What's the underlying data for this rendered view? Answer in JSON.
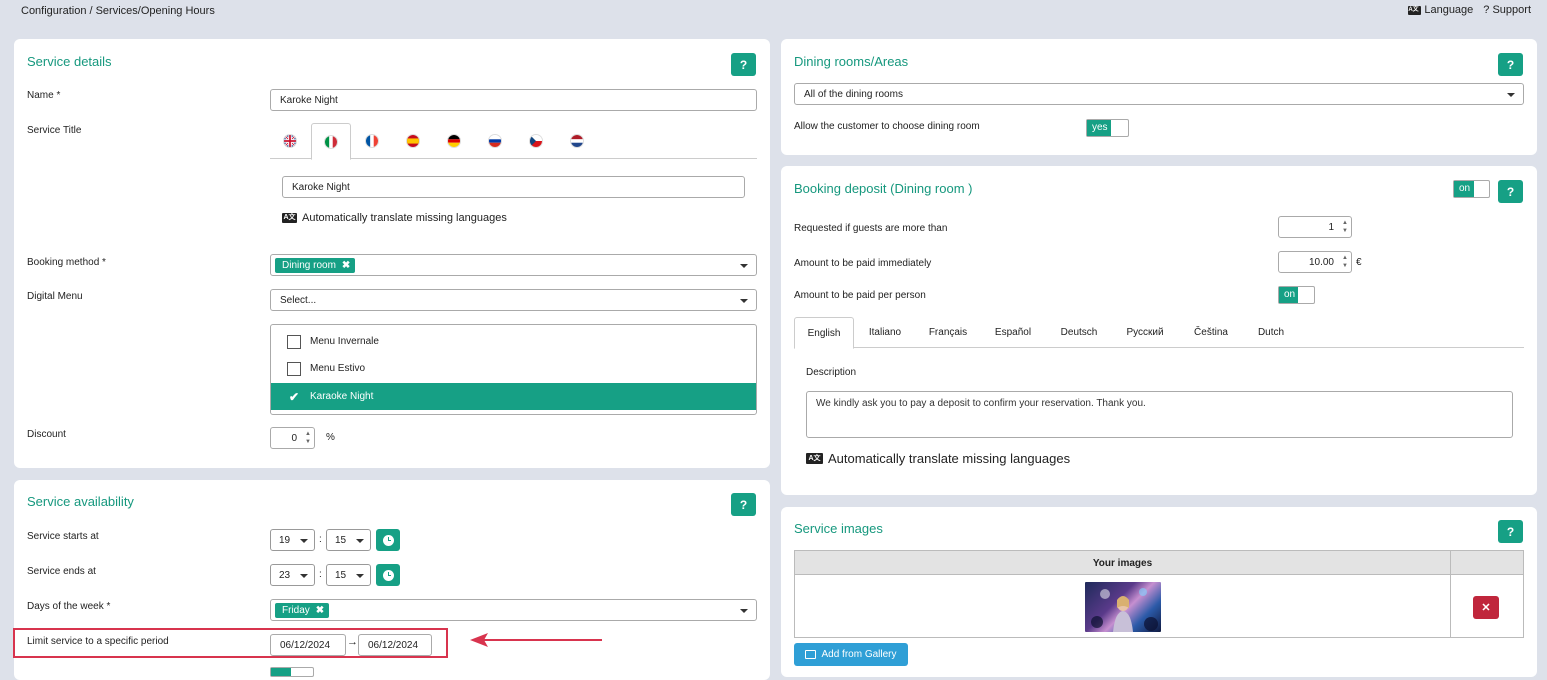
{
  "topbar": {
    "breadcrumb": "Configuration / Services/Opening Hours",
    "language_label": "Language",
    "support_label": "? Support"
  },
  "help_label": "?",
  "service_details": {
    "title": "Service details",
    "name_label": "Name *",
    "name_value": "Karoke Night",
    "service_title_label": "Service Title",
    "flags": [
      "flag-uk-icon",
      "flag-it-icon",
      "flag-fr-icon",
      "flag-es-icon",
      "flag-de-icon",
      "flag-ru-icon",
      "flag-cz-icon",
      "flag-nl-icon"
    ],
    "active_flag_index": 1,
    "title_value": "Karoke Night",
    "auto_translate_label": "Automatically translate missing languages",
    "booking_method_label": "Booking method *",
    "booking_method_tag": "Dining room",
    "digital_menu_label": "Digital Menu",
    "digital_menu_placeholder": "Select...",
    "menu_items": [
      {
        "label": "Menu Invernale",
        "selected": false
      },
      {
        "label": "Menu Estivo",
        "selected": false
      },
      {
        "label": "Karaoke Night",
        "selected": true
      }
    ],
    "discount_label": "Discount",
    "discount_value": "0",
    "discount_unit": "%"
  },
  "service_availability": {
    "title": "Service availability",
    "starts_label": "Service starts at",
    "starts_hour": "19",
    "starts_minute": "15",
    "ends_label": "Service ends at",
    "ends_hour": "23",
    "ends_minute": "15",
    "colon": ":",
    "days_label": "Days of the week *",
    "days_tag": "Friday",
    "limit_label": "Limit service to a specific period",
    "limit_from": "06/12/2024",
    "limit_to": "06/12/2024",
    "period_arrow": "→"
  },
  "dining_rooms": {
    "title": "Dining rooms/Areas",
    "select_value": "All of the dining rooms",
    "allow_label": "Allow the customer to choose dining room",
    "allow_toggle": "yes"
  },
  "booking_deposit": {
    "title": "Booking deposit (Dining room )",
    "toggle": "on",
    "guests_label": "Requested if guests are more than",
    "guests_value": "1",
    "amount_label": "Amount to be paid immediately",
    "amount_value": "10.00",
    "currency": "€",
    "per_person_label": "Amount to be paid per person",
    "per_person_toggle": "on",
    "tabs": [
      "English",
      "Italiano",
      "Français",
      "Español",
      "Deutsch",
      "Русский",
      "Čeština",
      "Dutch"
    ],
    "active_tab_index": 0,
    "description_label": "Description",
    "description_value": "We kindly ask you to pay a deposit to confirm your reservation. Thank you.",
    "auto_translate_label": "Automatically translate missing languages"
  },
  "service_images": {
    "title": "Service images",
    "column_images": "Your images",
    "delete_label": "✕",
    "add_gallery_label": "Add from Gallery"
  },
  "colors": {
    "accent": "#16a085",
    "title": "#16987e",
    "danger": "#c0263c",
    "info": "#2f9fd6",
    "highlight": "#d8344e"
  }
}
